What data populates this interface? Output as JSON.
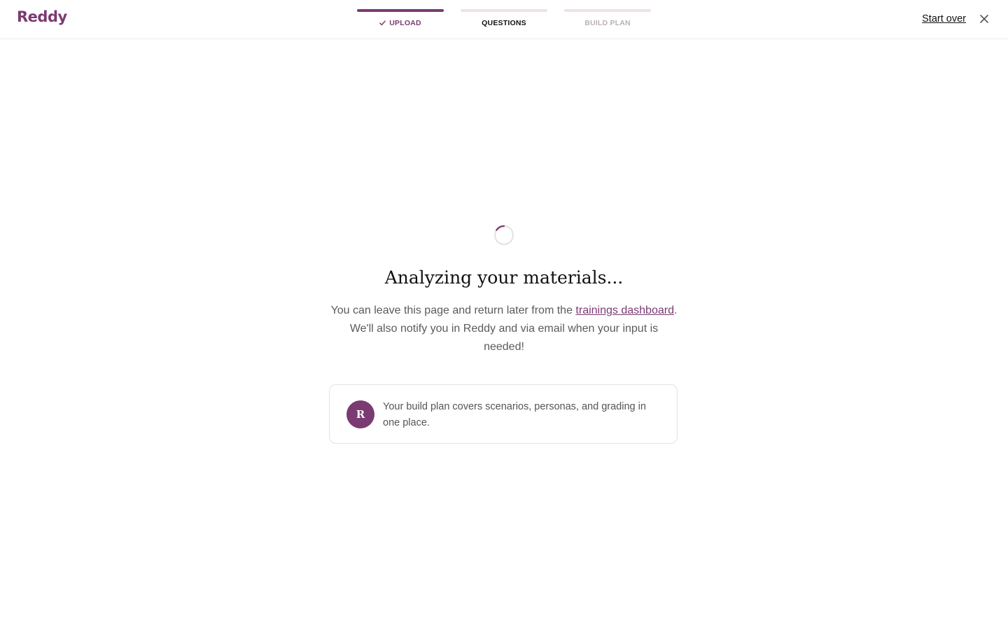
{
  "app": {
    "logo_text": "Reddy",
    "brand_color": "#7b3a72"
  },
  "steps": [
    {
      "label": "UPLOAD",
      "state": "done",
      "icon": "check-icon"
    },
    {
      "label": "QUESTIONS",
      "state": "active"
    },
    {
      "label": "BUILD PLAN",
      "state": "pending"
    }
  ],
  "header": {
    "start_over_label": "Start over",
    "close_icon": "close-icon"
  },
  "main": {
    "heading": "Analyzing your materials...",
    "sub_before_link": "You can leave this page and return later from the ",
    "sub_link": "trainings dashboard",
    "sub_after_link": ". We'll also notify you in Reddy and via email when your input is needed!"
  },
  "tip": {
    "avatar_letter": "R",
    "text": "Your build plan covers scenarios, personas, and grading in one place."
  }
}
